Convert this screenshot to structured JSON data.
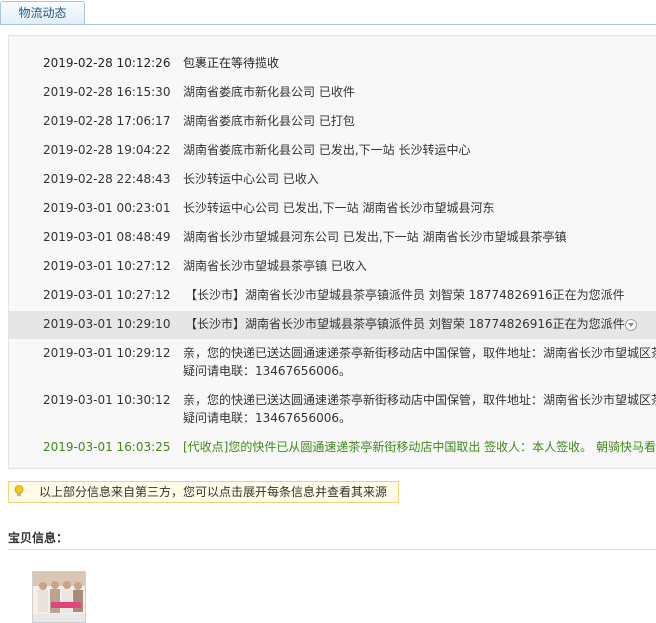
{
  "tab": {
    "label": "物流动态"
  },
  "events": [
    {
      "time": "2019-02-28 10:12:26",
      "desc": "包裹正在等待揽收"
    },
    {
      "time": "2019-02-28 16:15:30",
      "desc": "湖南省娄底市新化县公司 已收件"
    },
    {
      "time": "2019-02-28 17:06:17",
      "desc": "湖南省娄底市新化县公司 已打包"
    },
    {
      "time": "2019-02-28 19:04:22",
      "desc": "湖南省娄底市新化县公司 已发出,下一站 长沙转运中心"
    },
    {
      "time": "2019-02-28 22:48:43",
      "desc": "长沙转运中心公司 已收入"
    },
    {
      "time": "2019-03-01 00:23:01",
      "desc": "长沙转运中心公司 已发出,下一站 湖南省长沙市望城县河东"
    },
    {
      "time": "2019-03-01 08:48:49",
      "desc": "湖南省长沙市望城县河东公司 已发出,下一站 湖南省长沙市望城县茶亭镇"
    },
    {
      "time": "2019-03-01 10:27:12",
      "desc": "湖南省长沙市望城县茶亭镇 已收入"
    },
    {
      "time": "2019-03-01 10:27:12",
      "desc": "【长沙市】湖南省长沙市望城县茶亭镇派件员 刘智荣 18774826916正在为您派件"
    },
    {
      "time": "2019-03-01 10:29:10",
      "desc": "【长沙市】湖南省长沙市望城县茶亭镇派件员 刘智荣 18774826916正在为您派件"
    },
    {
      "time": "2019-03-01 10:29:12",
      "desc": "亲，您的快递已送达圆通速递茶亭新街移动店中国保管，取件地址：湖南省长沙市望城区茶亭镇",
      "desc2": "疑问请电联：13467656006。"
    },
    {
      "time": "2019-03-01 10:30:12",
      "desc": "亲，您的快递已送达圆通速递茶亭新街移动店中国保管，取件地址：湖南省长沙市望城区茶亭镇",
      "desc2": "疑问请电联：13467656006。"
    },
    {
      "time": "2019-03-01 16:03:25",
      "desc": "[代收点]您的快件已从圆通速递茶亭新街移动店中国取出 签收人：本人签收。 朝骑快马看"
    }
  ],
  "notice": {
    "text": "以上部分信息来自第三方，您可以点击展开每条信息并查看其来源"
  },
  "item_section": {
    "title": "宝贝信息："
  },
  "colors": {
    "accent": "#1a5a96",
    "delivered": "#3f8a1c",
    "notice_bg": "#fffbe6"
  }
}
